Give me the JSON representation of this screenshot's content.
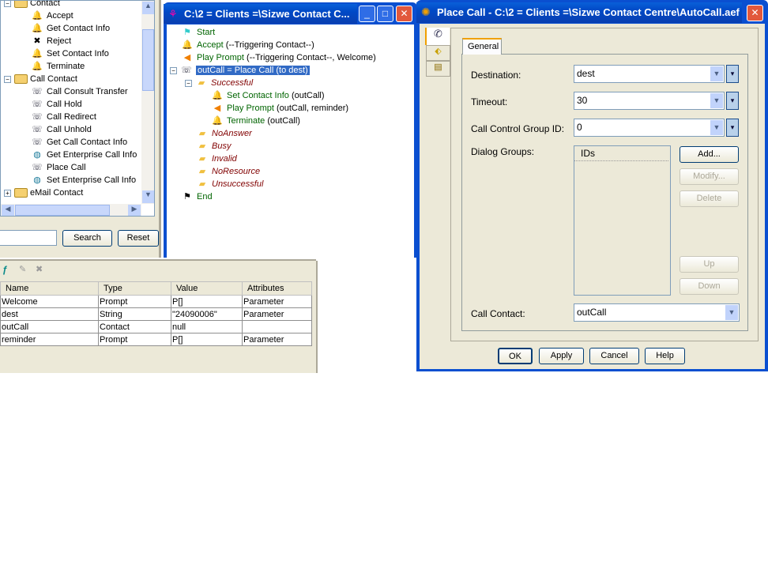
{
  "palette": {
    "items": [
      {
        "type": "folder",
        "label": "Contact",
        "level": 0,
        "expander": "−"
      },
      {
        "type": "step",
        "label": "Accept",
        "level": 1,
        "icon": "accept-bell-icon"
      },
      {
        "type": "step",
        "label": "Get Contact Info",
        "level": 1,
        "icon": "get-info-bell-icon"
      },
      {
        "type": "step",
        "label": "Reject",
        "level": 1,
        "icon": "reject-icon"
      },
      {
        "type": "step",
        "label": "Set Contact Info",
        "level": 1,
        "icon": "set-info-bell-icon"
      },
      {
        "type": "step",
        "label": "Terminate",
        "level": 1,
        "icon": "terminate-bell-icon"
      },
      {
        "type": "folder",
        "label": "Call Contact",
        "level": 0,
        "expander": "−"
      },
      {
        "type": "step",
        "label": "Call Consult Transfer",
        "level": 1,
        "icon": "phone-transfer-icon"
      },
      {
        "type": "step",
        "label": "Call Hold",
        "level": 1,
        "icon": "phone-hold-icon"
      },
      {
        "type": "step",
        "label": "Call Redirect",
        "level": 1,
        "icon": "phone-redirect-icon"
      },
      {
        "type": "step",
        "label": "Call Unhold",
        "level": 1,
        "icon": "phone-unhold-icon"
      },
      {
        "type": "step",
        "label": "Get Call Contact Info",
        "level": 1,
        "icon": "phone-info-icon"
      },
      {
        "type": "step",
        "label": "Get Enterprise Call Info",
        "level": 1,
        "icon": "globe-phone-icon"
      },
      {
        "type": "step",
        "label": "Place Call",
        "level": 1,
        "icon": "place-call-icon"
      },
      {
        "type": "step",
        "label": "Set Enterprise Call Info",
        "level": 1,
        "icon": "globe-phone-icon"
      },
      {
        "type": "folder",
        "label": "eMail Contact",
        "level": 0,
        "expander": "+"
      }
    ],
    "search_value": "",
    "search_label": "Search",
    "reset_label": "Reset"
  },
  "designer": {
    "title": "C:\\2 = Clients =\\Sizwe Contact C...",
    "rows": [
      {
        "level": 0,
        "name": "Start",
        "args": "",
        "kind": "step",
        "icon": "start-flag-icon"
      },
      {
        "level": 0,
        "name": "Accept",
        "args": " (--Triggering Contact--)",
        "kind": "step",
        "icon": "accept-bell-icon"
      },
      {
        "level": 0,
        "name": "Play Prompt",
        "args": " (--Triggering Contact--, Welcome)",
        "kind": "step",
        "icon": "speaker-icon"
      },
      {
        "level": 0,
        "name": "outCall = Place Call (to dest)",
        "args": "",
        "kind": "selected",
        "icon": "place-call-icon",
        "expander": "−"
      },
      {
        "level": 1,
        "name": "Successful",
        "args": "",
        "kind": "branch",
        "icon": "branch-icon",
        "expander": "−"
      },
      {
        "level": 2,
        "name": "Set Contact Info",
        "args": " (outCall)",
        "kind": "step",
        "icon": "set-info-bell-icon"
      },
      {
        "level": 2,
        "name": "Play Prompt",
        "args": " (outCall, reminder)",
        "kind": "step",
        "icon": "speaker-icon"
      },
      {
        "level": 2,
        "name": "Terminate",
        "args": " (outCall)",
        "kind": "step",
        "icon": "terminate-bell-icon"
      },
      {
        "level": 1,
        "name": "NoAnswer",
        "args": "",
        "kind": "branch",
        "icon": "branch-icon"
      },
      {
        "level": 1,
        "name": "Busy",
        "args": "",
        "kind": "branch",
        "icon": "branch-icon"
      },
      {
        "level": 1,
        "name": "Invalid",
        "args": "",
        "kind": "branch",
        "icon": "branch-icon"
      },
      {
        "level": 1,
        "name": "NoResource",
        "args": "",
        "kind": "branch",
        "icon": "branch-icon"
      },
      {
        "level": 1,
        "name": "Unsuccessful",
        "args": "",
        "kind": "branch",
        "icon": "branch-icon"
      },
      {
        "level": 0,
        "name": "End",
        "args": "",
        "kind": "step",
        "icon": "end-flag-icon"
      }
    ]
  },
  "variables": {
    "columns": [
      "Name",
      "Type",
      "Value",
      "Attributes"
    ],
    "rows": [
      [
        "Welcome",
        "Prompt",
        "P[]",
        "Parameter"
      ],
      [
        "dest",
        "String",
        "\"24090006\"",
        "Parameter"
      ],
      [
        "outCall",
        "Contact",
        "null",
        ""
      ],
      [
        "reminder",
        "Prompt",
        "P[]",
        "Parameter"
      ]
    ]
  },
  "dialog": {
    "title": "Place Call - C:\\2 = Clients =\\Sizwe Contact Centre\\AutoCall.aef",
    "tab": "General",
    "destination_label": "Destination:",
    "destination_value": "dest",
    "timeout_label": "Timeout:",
    "timeout_value": "30",
    "ccg_label": "Call Control Group ID:",
    "ccg_value": "0",
    "dialog_groups_label": "Dialog Groups:",
    "ids_header": "IDs",
    "add": "Add...",
    "modify": "Modify...",
    "delete": "Delete",
    "up": "Up",
    "down": "Down",
    "call_contact_label": "Call Contact:",
    "call_contact_value": "outCall",
    "ok": "OK",
    "apply": "Apply",
    "cancel": "Cancel",
    "help": "Help"
  },
  "colors": {
    "titlebar": "#0a4fd0",
    "selection": "#316ac5",
    "step_green": "#006400",
    "branch_maroon": "#800000"
  }
}
